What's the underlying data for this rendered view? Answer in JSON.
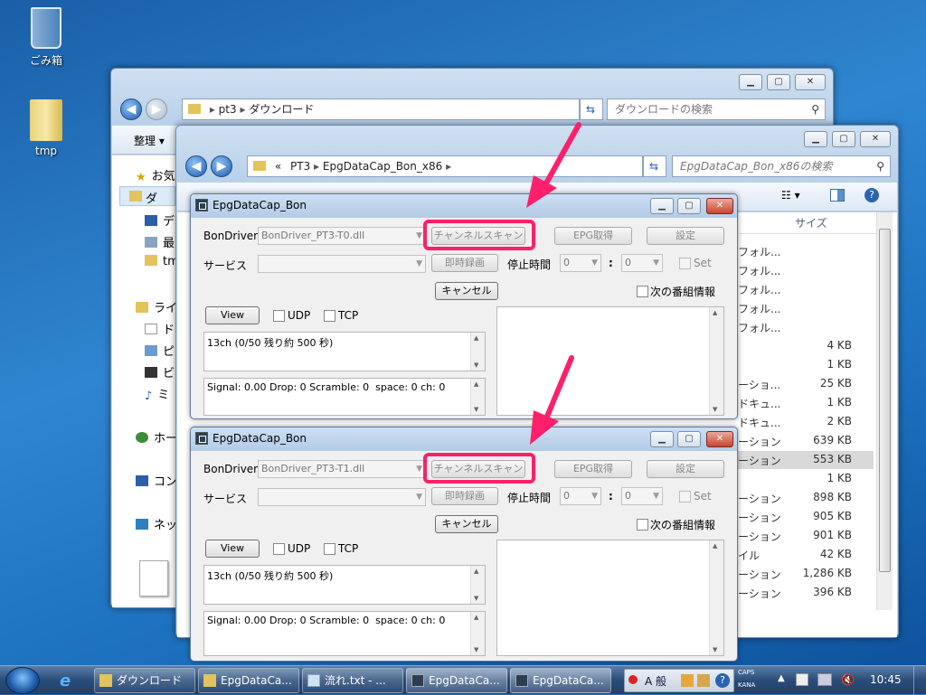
{
  "desktop": {
    "icons": [
      {
        "label": "ごみ箱"
      },
      {
        "label": "tmp"
      }
    ]
  },
  "explorer_back": {
    "breadcrumb": [
      "pt3",
      "ダウンロード"
    ],
    "search_placeholder": "ダウンロードの検索",
    "toolbar_organize": "整理",
    "sidebar": [
      {
        "label": "お気",
        "icon": "star-icon"
      },
      {
        "label": "ダ",
        "icon": "folder-icon"
      },
      {
        "label": "デ",
        "icon": "desktop-icon"
      },
      {
        "label": "最",
        "icon": "recent-icon"
      },
      {
        "label": "tm",
        "icon": "folder-icon"
      },
      {
        "label": "ライ",
        "icon": "library-icon"
      },
      {
        "label": "ド",
        "icon": "document-icon"
      },
      {
        "label": "ピ",
        "icon": "picture-icon"
      },
      {
        "label": "ビ",
        "icon": "video-icon"
      },
      {
        "label": "ミ",
        "icon": "music-icon"
      },
      {
        "label": "ホー",
        "icon": "homegroup-icon"
      },
      {
        "label": "コン",
        "icon": "computer-icon"
      },
      {
        "label": "ネッ",
        "icon": "network-icon"
      }
    ]
  },
  "explorer_front": {
    "breadcrumb_prefix": "«",
    "breadcrumb": [
      "PT3",
      "EpgDataCap_Bon_x86"
    ],
    "search_placeholder": "EpgDataCap_Bon_x86の検索",
    "column_size": "サイズ",
    "rows": [
      {
        "type": "フォル...",
        "size": ""
      },
      {
        "type": "フォル...",
        "size": ""
      },
      {
        "type": "フォル...",
        "size": ""
      },
      {
        "type": "フォル...",
        "size": ""
      },
      {
        "type": "フォル...",
        "size": ""
      },
      {
        "type": "",
        "size": "4 KB"
      },
      {
        "type": "",
        "size": "1 KB"
      },
      {
        "type": "ーショ...",
        "size": "25 KB"
      },
      {
        "type": "ドキュ...",
        "size": "1 KB"
      },
      {
        "type": "ドキュ...",
        "size": "2 KB"
      },
      {
        "type": "ーション",
        "size": "639 KB"
      },
      {
        "type": "ーション",
        "size": "553 KB",
        "selected": true
      },
      {
        "type": "",
        "size": "1 KB"
      },
      {
        "type": "ーション",
        "size": "898 KB"
      },
      {
        "type": "ーション",
        "size": "905 KB"
      },
      {
        "type": "ーション",
        "size": "901 KB"
      },
      {
        "type": "イル",
        "size": "42 KB"
      },
      {
        "type": "ーション",
        "size": "1,286 KB"
      },
      {
        "type": "ーション",
        "size": "396 KB"
      }
    ]
  },
  "epg1": {
    "title": "EpgDataCap_Bon",
    "bondriver_label": "BonDriver",
    "bondriver_value": "BonDriver_PT3-T0.dll",
    "channel_scan": "チャンネルスキャン",
    "epg_get": "EPG取得",
    "settings": "設定",
    "service_label": "サービス",
    "instant_rec": "即時録画",
    "stop_time_label": "停止時間",
    "stop_h": "0",
    "stop_m": "0",
    "colon": ":",
    "set_label": "Set",
    "cancel": "キャンセル",
    "next_program": "次の番組情報",
    "view": "View",
    "udp": "UDP",
    "tcp": "TCP",
    "status": "13ch (0/50 残り約 500 秒)",
    "signal": "Signal: 0.00 Drop: 0 Scramble: 0  space: 0 ch: 0"
  },
  "epg2": {
    "title": "EpgDataCap_Bon",
    "bondriver_label": "BonDriver",
    "bondriver_value": "BonDriver_PT3-T1.dll",
    "channel_scan": "チャンネルスキャン",
    "epg_get": "EPG取得",
    "settings": "設定",
    "service_label": "サービス",
    "instant_rec": "即時録画",
    "stop_time_label": "停止時間",
    "stop_h": "0",
    "stop_m": "0",
    "colon": ":",
    "set_label": "Set",
    "cancel": "キャンセル",
    "next_program": "次の番組情報",
    "view": "View",
    "udp": "UDP",
    "tcp": "TCP",
    "status": "13ch (0/50 残り約 500 秒)",
    "signal": "Signal: 0.00 Drop: 0 Scramble: 0  space: 0 ch: 0"
  },
  "taskbar": {
    "items": [
      {
        "label": "ダウンロード"
      },
      {
        "label": "EpgDataCa..."
      },
      {
        "label": "流れ.txt - ..."
      },
      {
        "label": "EpgDataCa..."
      },
      {
        "label": "EpgDataCa..."
      }
    ],
    "ime": "A 般",
    "caps": "CAPS",
    "kana": "KANA",
    "clock": "10:45"
  },
  "colors": {
    "highlight": "#ff1f6a",
    "accent": "#2f86d0"
  }
}
